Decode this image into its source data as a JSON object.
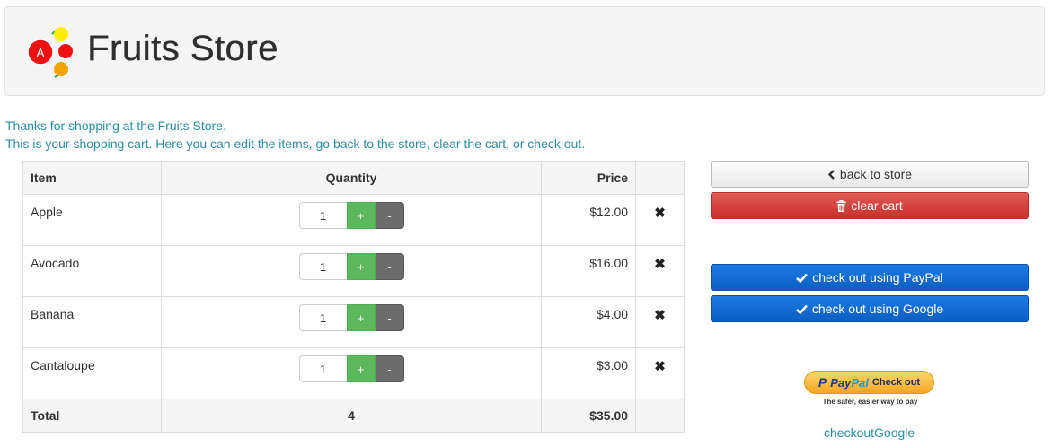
{
  "header": {
    "title": "Fruits Store",
    "logo_letter": "A"
  },
  "intro": {
    "line1": "Thanks for shopping at the Fruits Store.",
    "line2": "This is your shopping cart. Here you can edit the items, go back to the store, clear the cart, or check out."
  },
  "cart": {
    "columns": {
      "item": "Item",
      "quantity": "Quantity",
      "price": "Price"
    },
    "rows": [
      {
        "name": "Apple",
        "quantity": "1",
        "price": "$12.00"
      },
      {
        "name": "Avocado",
        "quantity": "1",
        "price": "$16.00"
      },
      {
        "name": "Banana",
        "quantity": "1",
        "price": "$4.00"
      },
      {
        "name": "Cantaloupe",
        "quantity": "1",
        "price": "$3.00"
      }
    ],
    "plus_label": "+",
    "minus_label": "-",
    "remove_icon": "close-icon",
    "total": {
      "label": "Total",
      "quantity": "4",
      "price": "$35.00"
    }
  },
  "actions": {
    "back_to_store": "back to store",
    "clear_cart": "clear cart",
    "checkout_paypal": "check out using PayPal",
    "checkout_google": "check out using Google",
    "paypal_badge_brand_pay": "Pay",
    "paypal_badge_brand_pal": "Pal",
    "paypal_badge_action": "Check out",
    "paypal_badge_tagline": "The safer, easier way to pay",
    "checkout_google_link": "checkoutGoogle"
  },
  "colors": {
    "link": "#2a8ea8",
    "success": "#5cb85c",
    "danger": "#d9534f",
    "primary": "#0c6fd8"
  }
}
